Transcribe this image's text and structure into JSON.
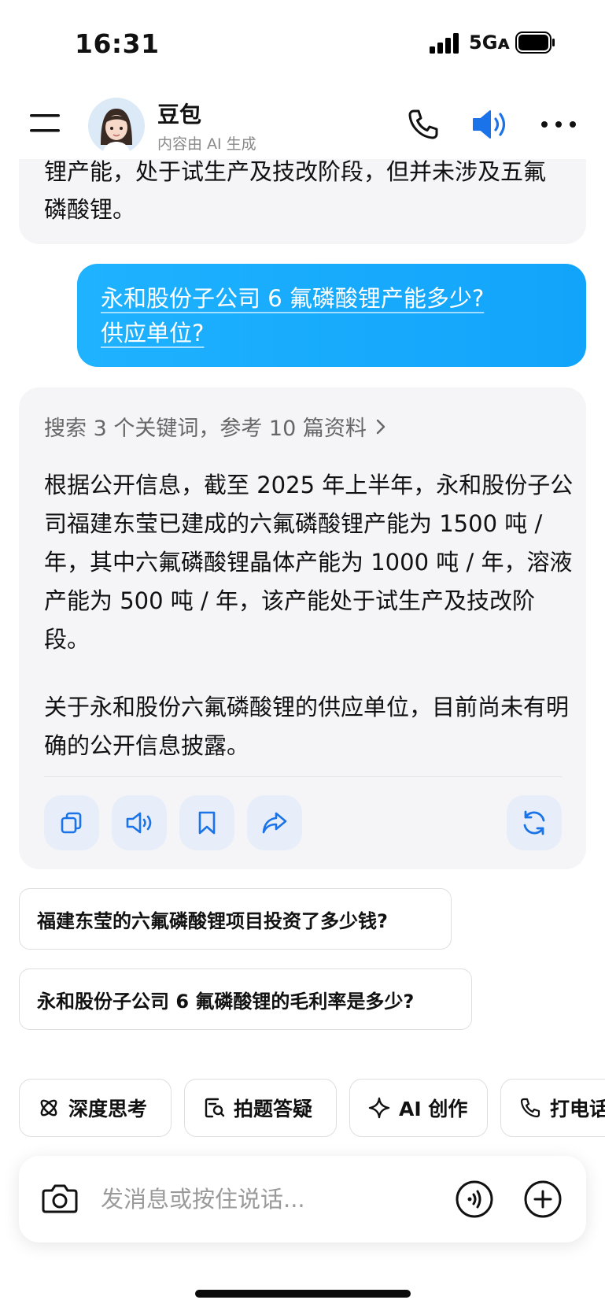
{
  "status_bar": {
    "time": "16:31",
    "network": "5Gᴀ"
  },
  "header": {
    "title": "豆包",
    "subtitle": "内容由 AI 生成"
  },
  "previous_message": {
    "text": "锂产能，处于试生产及技改阶段，但并未涉及五氟磷酸锂。"
  },
  "user_message": {
    "line1": "永和股份子公司 6 氟磷酸锂产能多少?",
    "line2": "供应单位?"
  },
  "ai_answer": {
    "search_summary": "搜索 3 个关键词，参考 10 篇资料",
    "paragraph1": "根据公开信息，截至 2025 年上半年，永和股份子公司福建东莹已建成的六氟磷酸锂产能为 1500 吨 / 年，其中六氟磷酸锂晶体产能为 1000 吨 / 年，溶液产能为 500 吨 / 年，该产能处于试生产及技改阶段。",
    "paragraph2": "关于永和股份六氟磷酸锂的供应单位，目前尚未有明确的公开信息披露。"
  },
  "suggestions": [
    "福建东莹的六氟磷酸锂项目投资了多少钱?",
    "永和股份子公司 6 氟磷酸锂的毛利率是多少?"
  ],
  "chips": [
    {
      "label": "深度思考",
      "icon": "atom-icon"
    },
    {
      "label": "拍题答疑",
      "icon": "scan-question-icon"
    },
    {
      "label": "AI 创作",
      "icon": "sparkle-icon"
    },
    {
      "label": "打电话",
      "icon": "phone-icon"
    }
  ],
  "input": {
    "placeholder": "发消息或按住说话..."
  },
  "colors": {
    "accent_blue": "#1a73e8",
    "user_bubble": "#18aafc",
    "card_bg": "#f5f5f7"
  }
}
